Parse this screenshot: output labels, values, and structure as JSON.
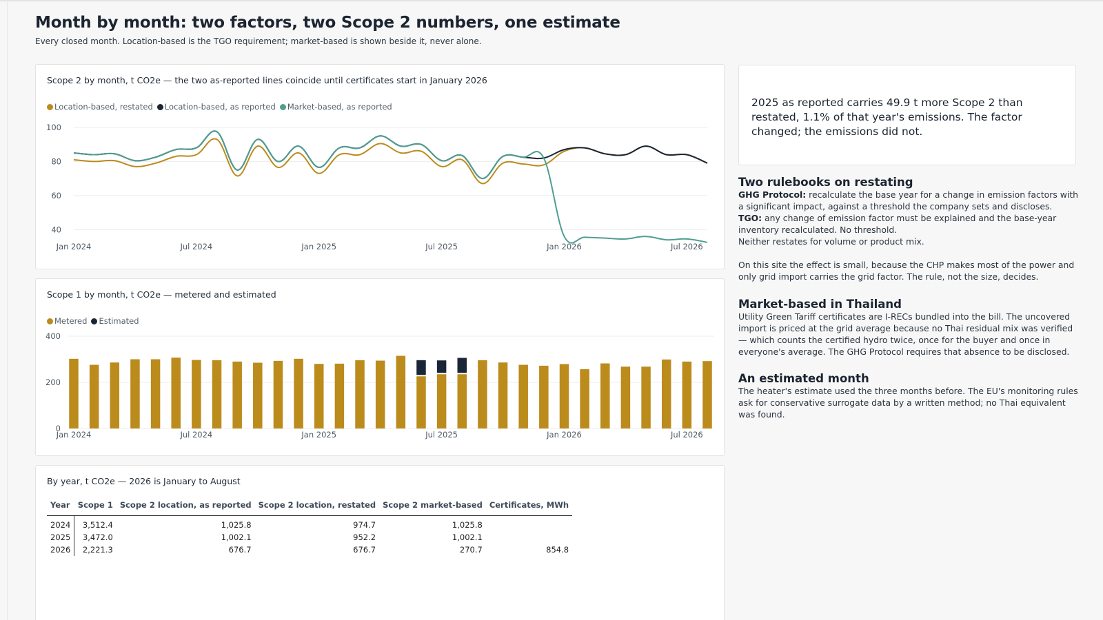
{
  "page": {
    "title": "Month by month: two factors, two Scope 2 numbers, one estimate",
    "subtitle": "Every closed month. Location-based is the TGO requirement; market-based is shown beside it, never alone."
  },
  "colors": {
    "gold": "#bb8b1c",
    "navy": "#1a2636",
    "teal": "#4f9e90",
    "grid": "#ececec"
  },
  "chart_data": [
    {
      "type": "line",
      "title": "Scope 2 by month, t CO2e — the two as-reported lines coincide until certificates start in January 2026",
      "x": [
        "2024-01",
        "2024-02",
        "2024-03",
        "2024-04",
        "2024-05",
        "2024-06",
        "2024-07",
        "2024-08",
        "2024-09",
        "2024-10",
        "2024-11",
        "2024-12",
        "2025-01",
        "2025-02",
        "2025-03",
        "2025-04",
        "2025-05",
        "2025-06",
        "2025-07",
        "2025-08",
        "2025-09",
        "2025-10",
        "2025-11",
        "2025-12",
        "2026-01",
        "2026-02",
        "2026-03",
        "2026-04",
        "2026-05",
        "2026-06",
        "2026-07",
        "2026-08"
      ],
      "x_tick_labels": [
        "Jan 2024",
        "Jul 2024",
        "Jan 2025",
        "Jul 2025",
        "Jan 2026",
        "Jul 2026"
      ],
      "x_tick_months": [
        "2024-01",
        "2024-07",
        "2025-01",
        "2025-07",
        "2026-01",
        "2026-07"
      ],
      "yticks": [
        40,
        60,
        80,
        100
      ],
      "ylim": [
        30,
        102
      ],
      "series": [
        {
          "name": "Location-based, restated",
          "color": "#bb8b1c",
          "values": [
            81,
            80,
            80.5,
            77,
            79,
            83,
            84,
            93,
            71.5,
            89,
            76.5,
            85,
            73,
            84,
            84,
            90.5,
            85,
            86,
            77,
            81,
            67,
            79,
            78.5,
            78,
            86,
            88,
            84.5,
            84,
            89,
            84,
            84,
            79
          ]
        },
        {
          "name": "Location-based, as reported",
          "color": "#1a2636",
          "values": [
            85,
            84,
            84.5,
            80.5,
            82.5,
            87,
            88,
            97.5,
            75,
            93,
            80,
            89,
            76.5,
            88,
            88,
            95,
            89,
            90,
            80.5,
            83.5,
            70,
            83,
            82.5,
            82,
            87,
            88,
            84.5,
            84,
            89,
            84,
            84,
            79
          ]
        },
        {
          "name": "Market-based, as reported",
          "color": "#4f9e90",
          "values": [
            85,
            84,
            84.5,
            80.5,
            82.5,
            87,
            88,
            97.5,
            75,
            93,
            80,
            89,
            76.5,
            88,
            88,
            95,
            89,
            90,
            80.5,
            83.5,
            70,
            83,
            82.5,
            82,
            36,
            35.5,
            35,
            34.5,
            36,
            34,
            34.5,
            32.5
          ]
        }
      ]
    },
    {
      "type": "bar",
      "stacked": true,
      "title": "Scope 1 by month, t CO2e — metered and estimated",
      "x": [
        "2024-01",
        "2024-02",
        "2024-03",
        "2024-04",
        "2024-05",
        "2024-06",
        "2024-07",
        "2024-08",
        "2024-09",
        "2024-10",
        "2024-11",
        "2024-12",
        "2025-01",
        "2025-02",
        "2025-03",
        "2025-04",
        "2025-05",
        "2025-06",
        "2025-07",
        "2025-08",
        "2025-09",
        "2025-10",
        "2025-11",
        "2025-12",
        "2026-01",
        "2026-02",
        "2026-03",
        "2026-04",
        "2026-05",
        "2026-06",
        "2026-07",
        "2026-08"
      ],
      "x_tick_labels": [
        "Jan 2024",
        "Jul 2024",
        "Jan 2025",
        "Jul 2025",
        "Jan 2026",
        "Jul 2026"
      ],
      "x_tick_months": [
        "2024-01",
        "2024-07",
        "2025-01",
        "2025-07",
        "2026-01",
        "2026-07"
      ],
      "yticks": [
        0,
        200,
        400
      ],
      "ylim": [
        0,
        400
      ],
      "series": [
        {
          "name": "Metered",
          "color": "#bb8b1c",
          "values": [
            302,
            276,
            286,
            300,
            300,
            307,
            297,
            296,
            290,
            285,
            293,
            302,
            280,
            281,
            296,
            294,
            315,
            226,
            235,
            235,
            296,
            286,
            276,
            272,
            279,
            257,
            282,
            268,
            268,
            299,
            290,
            292
          ]
        },
        {
          "name": "Estimated",
          "color": "#1a2636",
          "values": [
            0,
            0,
            0,
            0,
            0,
            0,
            0,
            0,
            0,
            0,
            0,
            0,
            0,
            0,
            0,
            0,
            0,
            70,
            60,
            71,
            0,
            0,
            0,
            0,
            0,
            0,
            0,
            0,
            0,
            0,
            0,
            0
          ]
        }
      ]
    },
    {
      "type": "table",
      "title": "By year, t CO2e — 2026 is January to August",
      "columns": [
        "Year",
        "Scope 1",
        "Scope 2 location, as reported",
        "Scope 2 location, restated",
        "Scope 2 market-based",
        "Certificates, MWh"
      ],
      "rows": [
        [
          "2024",
          "3,512.4",
          "1,025.8",
          "974.7",
          "1,025.8",
          ""
        ],
        [
          "2025",
          "3,472.0",
          "1,002.1",
          "952.2",
          "1,002.1",
          ""
        ],
        [
          "2026",
          "2,221.3",
          "676.7",
          "676.7",
          "270.7",
          "854.8"
        ]
      ]
    }
  ],
  "callout": {
    "text": "2025 as reported carries 49.9 t more Scope 2 than restated, 1.1% of that year's emissions. The factor changed; the emissions did not."
  },
  "side": {
    "rulebooks": {
      "heading": "Two rulebooks on restating",
      "ghg_label": "GHG Protocol:",
      "ghg_text": " recalculate the base year for a change in emission factors with a significant impact, against a threshold the company sets and discloses.",
      "tgo_label": "TGO:",
      "tgo_text": " any change of emission factor must be explained and the base-year inventory recalculated. No threshold.",
      "neither": "Neither restates for volume or product mix.",
      "effect": "On this site the effect is small, because the CHP makes most of the power and only grid import carries the grid factor. The rule, not the size, decides."
    },
    "market": {
      "heading": "Market-based in Thailand",
      "text": "Utility Green Tariff certificates are I-RECs bundled into the bill. The uncovered import is priced at the grid average because no Thai residual mix was verified — which counts the certified hydro twice, once for the buyer and once in everyone's average. The GHG Protocol requires that absence to be disclosed."
    },
    "estimated": {
      "heading": "An estimated month",
      "text": "The heater's estimate used the three months before. The EU's monitoring rules ask for conservative surrogate data by a written method; no Thai equivalent was found."
    }
  }
}
